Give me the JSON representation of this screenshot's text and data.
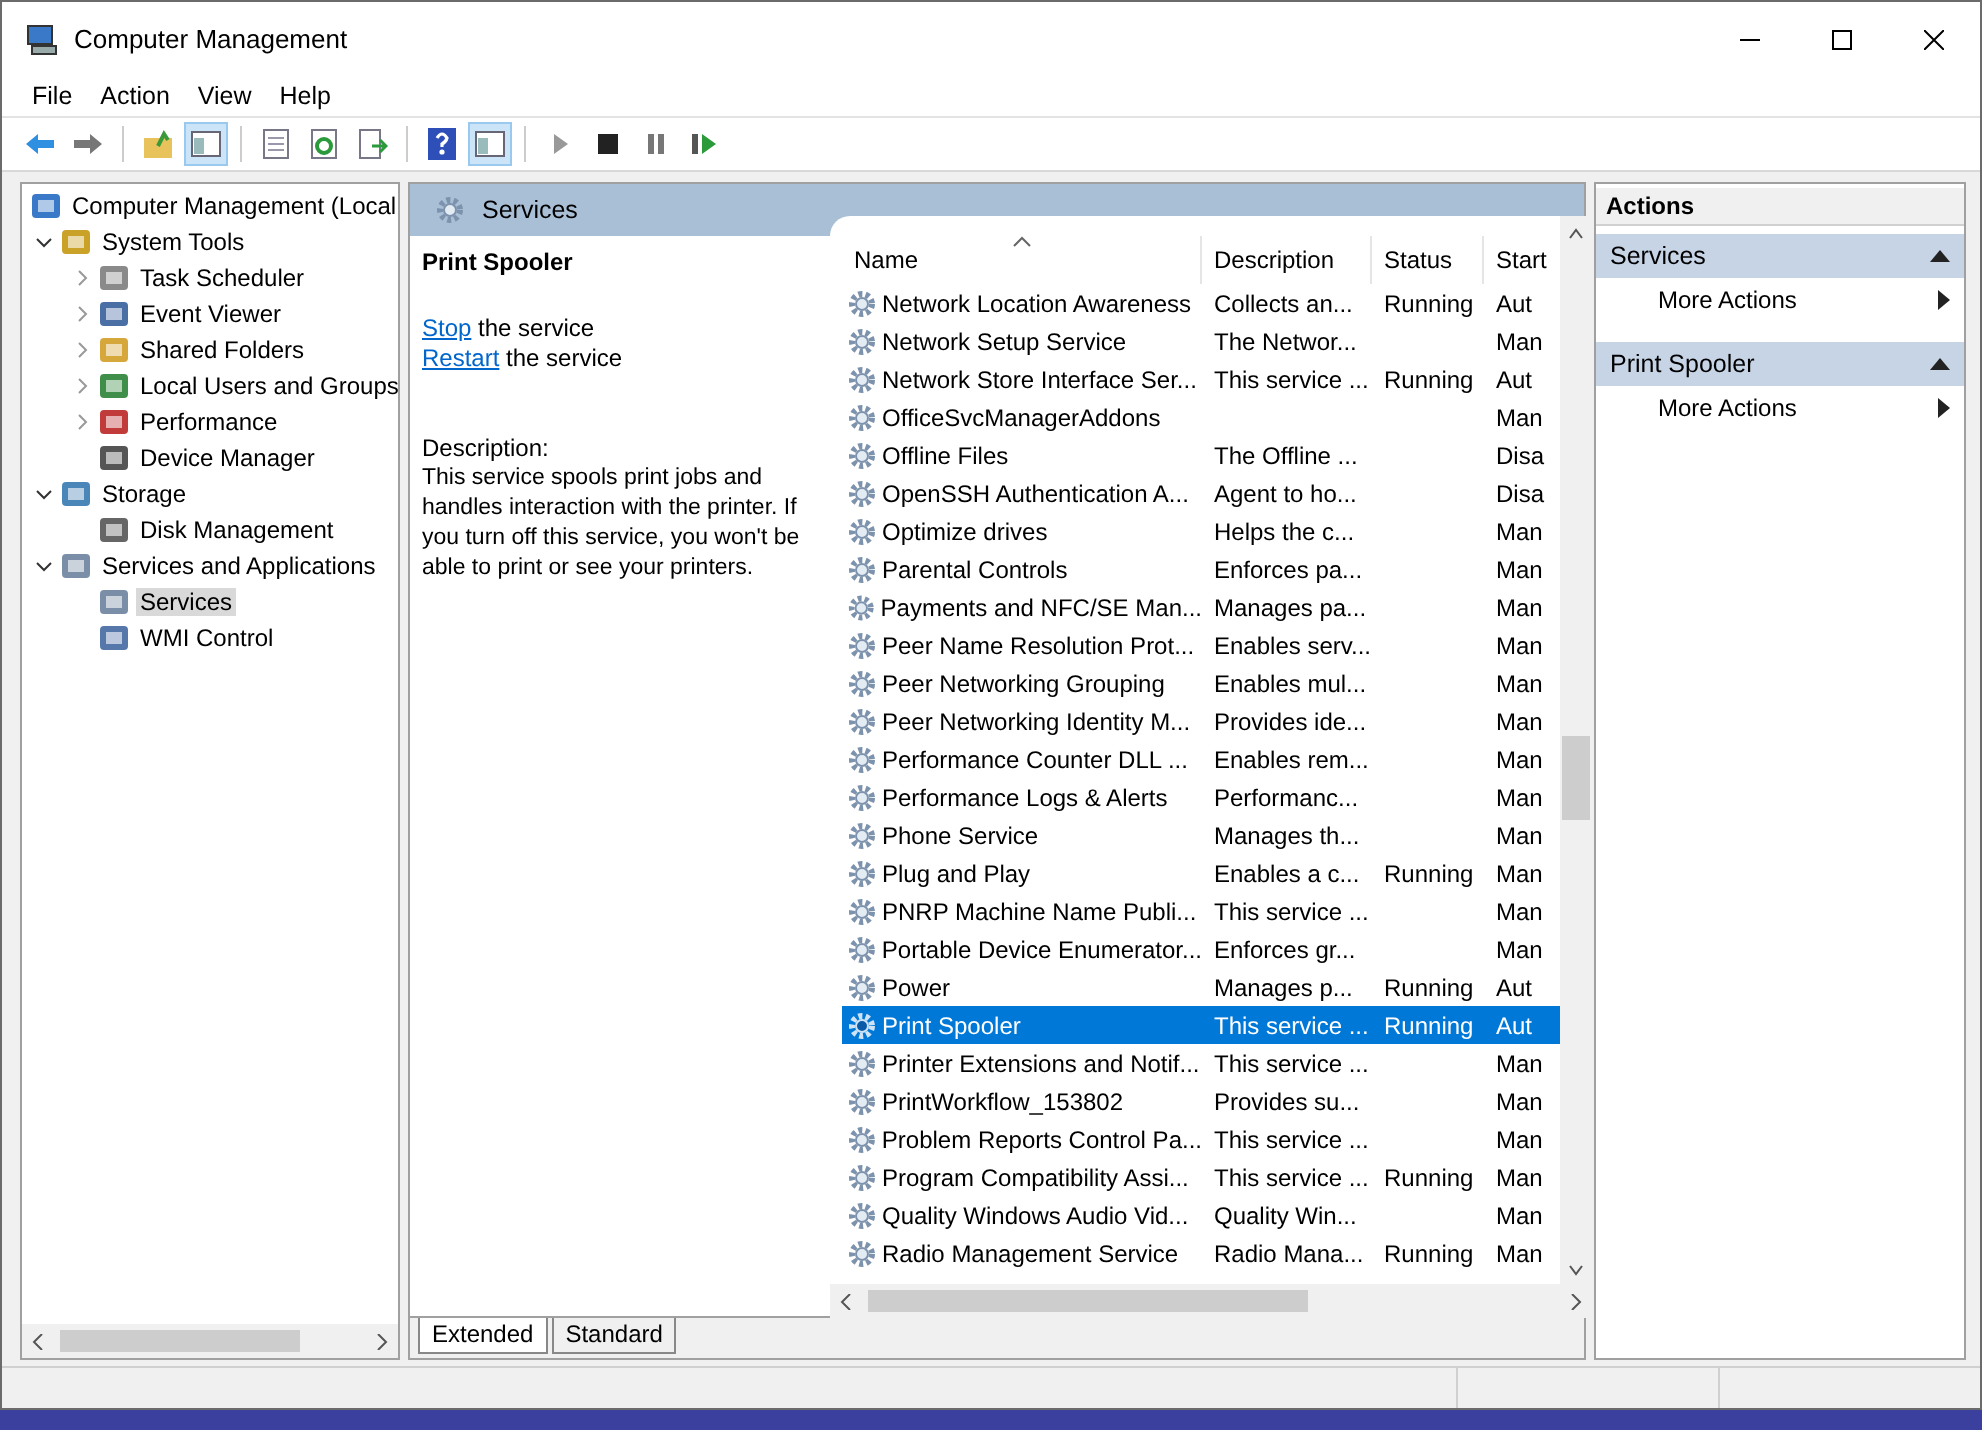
{
  "window": {
    "title": "Computer Management"
  },
  "menu": [
    "File",
    "Action",
    "View",
    "Help"
  ],
  "toolbar": [
    {
      "pressed": false
    },
    {
      "pressed": false
    },
    {
      "pressed": false
    },
    {
      "pressed": true
    },
    {
      "pressed": false
    },
    {
      "pressed": false
    },
    {
      "pressed": false
    },
    {
      "pressed": false
    },
    {
      "pressed": true
    },
    {
      "pressed": false
    },
    {
      "pressed": false
    },
    {
      "pressed": false
    },
    {
      "pressed": false
    }
  ],
  "tree": [
    {
      "label": "Computer Management (Local",
      "selected": false,
      "children": [
        {
          "label": "System Tools",
          "expanded": true,
          "selected": false,
          "children": [
            {
              "label": "Task Scheduler",
              "expanded": false,
              "selected": false
            },
            {
              "label": "Event Viewer",
              "expanded": false,
              "selected": false
            },
            {
              "label": "Shared Folders",
              "expanded": false,
              "selected": false
            },
            {
              "label": "Local Users and Groups",
              "expanded": false,
              "selected": false
            },
            {
              "label": "Performance",
              "expanded": false,
              "selected": false
            },
            {
              "label": "Device Manager",
              "selected": false
            }
          ]
        },
        {
          "label": "Storage",
          "expanded": true,
          "selected": false,
          "children": [
            {
              "label": "Disk Management",
              "selected": false
            }
          ]
        },
        {
          "label": "Services and Applications",
          "expanded": true,
          "selected": false,
          "children": [
            {
              "label": "Services",
              "selected": true
            },
            {
              "label": "WMI Control",
              "selected": false
            }
          ]
        }
      ]
    }
  ],
  "center": {
    "title": "Services",
    "service_name": "Print Spooler",
    "tasks": [
      {
        "link": "Stop",
        "rest": "the service"
      },
      {
        "link": "Restart",
        "rest": "the service"
      }
    ],
    "description_label": "Description:",
    "description": "This service spools print jobs and handles interaction with the printer. If you turn off this service, you won't be able to print or see your printers."
  },
  "table": {
    "columns": [
      {
        "label": "Name",
        "sorted": true
      },
      {
        "label": "Description",
        "sorted": false
      },
      {
        "label": "Status",
        "sorted": false
      },
      {
        "label": "Start",
        "sorted": false
      }
    ],
    "rows": [
      {
        "name": "Network Location Awareness",
        "description": "Collects an...",
        "status": "Running",
        "startup": "Aut",
        "selected": false
      },
      {
        "name": "Network Setup Service",
        "description": "The Networ...",
        "startup": "Man",
        "selected": false
      },
      {
        "name": "Network Store Interface Ser...",
        "description": "This service ...",
        "status": "Running",
        "startup": "Aut",
        "selected": false
      },
      {
        "name": "OfficeSvcManagerAddons",
        "startup": "Man",
        "selected": false
      },
      {
        "name": "Offline Files",
        "description": "The Offline ...",
        "startup": "Disa",
        "selected": false
      },
      {
        "name": "OpenSSH Authentication A...",
        "description": "Agent to ho...",
        "startup": "Disa",
        "selected": false
      },
      {
        "name": "Optimize drives",
        "description": "Helps the c...",
        "startup": "Man",
        "selected": false
      },
      {
        "name": "Parental Controls",
        "description": "Enforces pa...",
        "startup": "Man",
        "selected": false
      },
      {
        "name": "Payments and NFC/SE Man...",
        "description": "Manages pa...",
        "startup": "Man",
        "selected": false
      },
      {
        "name": "Peer Name Resolution Prot...",
        "description": "Enables serv...",
        "startup": "Man",
        "selected": false
      },
      {
        "name": "Peer Networking Grouping",
        "description": "Enables mul...",
        "startup": "Man",
        "selected": false
      },
      {
        "name": "Peer Networking Identity M...",
        "description": "Provides ide...",
        "startup": "Man",
        "selected": false
      },
      {
        "name": "Performance Counter DLL ...",
        "description": "Enables rem...",
        "startup": "Man",
        "selected": false
      },
      {
        "name": "Performance Logs & Alerts",
        "description": "Performanc...",
        "startup": "Man",
        "selected": false
      },
      {
        "name": "Phone Service",
        "description": "Manages th...",
        "startup": "Man",
        "selected": false
      },
      {
        "name": "Plug and Play",
        "description": "Enables a c...",
        "status": "Running",
        "startup": "Man",
        "selected": false
      },
      {
        "name": "PNRP Machine Name Publi...",
        "description": "This service ...",
        "startup": "Man",
        "selected": false
      },
      {
        "name": "Portable Device Enumerator...",
        "description": "Enforces gr...",
        "startup": "Man",
        "selected": false
      },
      {
        "name": "Power",
        "description": "Manages p...",
        "status": "Running",
        "startup": "Aut",
        "selected": false
      },
      {
        "name": "Print Spooler",
        "description": "This service ...",
        "status": "Running",
        "startup": "Aut",
        "selected": true
      },
      {
        "name": "Printer Extensions and Notif...",
        "description": "This service ...",
        "startup": "Man",
        "selected": false
      },
      {
        "name": "PrintWorkflow_153802",
        "description": "Provides su...",
        "startup": "Man",
        "selected": false
      },
      {
        "name": "Problem Reports Control Pa...",
        "description": "This service ...",
        "startup": "Man",
        "selected": false
      },
      {
        "name": "Program Compatibility Assi...",
        "description": "This service ...",
        "status": "Running",
        "startup": "Man",
        "selected": false
      },
      {
        "name": "Quality Windows Audio Vid...",
        "description": "Quality Win...",
        "startup": "Man",
        "selected": false
      },
      {
        "name": "Radio Management Service",
        "description": "Radio Mana...",
        "status": "Running",
        "startup": "Man",
        "selected": false
      }
    ]
  },
  "tabs": [
    {
      "label": "Extended",
      "selected": true
    },
    {
      "label": "Standard",
      "selected": false
    }
  ],
  "actions": {
    "title": "Actions",
    "sections": [
      {
        "title": "Services",
        "expanded": true,
        "items": [
          "More Actions"
        ]
      },
      {
        "title": "Print Spooler",
        "expanded": true,
        "items": [
          "More Actions"
        ]
      }
    ]
  }
}
